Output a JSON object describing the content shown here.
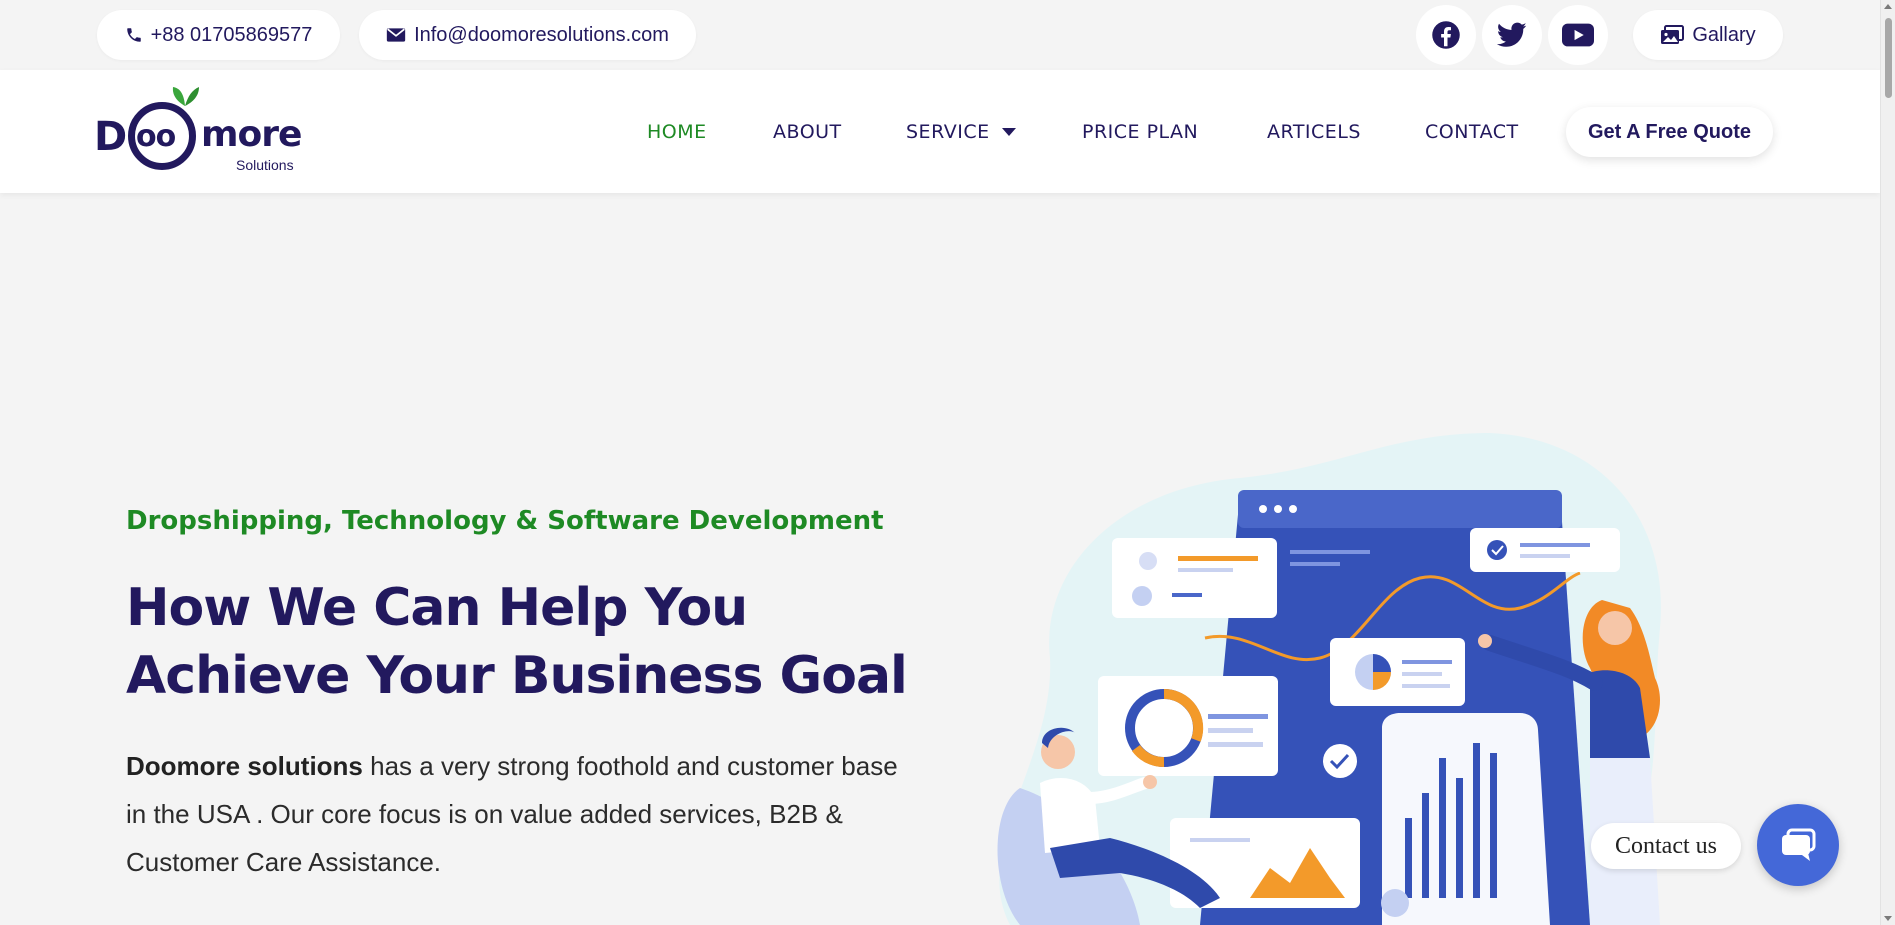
{
  "topbar": {
    "phone": "+88 01705869577",
    "email": "Info@doomoresolutions.com",
    "gallery": "Gallary",
    "icons": {
      "phone": "phone-icon",
      "email": "envelope-icon",
      "facebook": "facebook-icon",
      "twitter": "twitter-icon",
      "youtube": "youtube-icon",
      "gallery": "images-icon"
    }
  },
  "logo": {
    "d": "D",
    "oo": "oo",
    "more": "more",
    "sub": "Solutions"
  },
  "nav": {
    "items": [
      {
        "label": "HOME",
        "active": true
      },
      {
        "label": "ABOUT"
      },
      {
        "label": "SERVICE"
      },
      {
        "label": "PRICE PLAN"
      },
      {
        "label": "ARTICELS"
      },
      {
        "label": "CONTACT"
      }
    ],
    "cta": "Get A Free Quote"
  },
  "hero": {
    "tagline": "Dropshipping, Technology & Software Development",
    "title_line1": "How We Can Help You",
    "title_line2": "Achieve Your Business Goal",
    "desc_bold": "Doomore solutions",
    "desc_rest": " has a very strong foothold and customer base in the USA . Our core focus is on value added services, B2B & Customer Care Assistance."
  },
  "widget": {
    "label": "Contact us",
    "icon": "chat-icon"
  },
  "colors": {
    "navy": "#22195e",
    "green": "#1e8a24",
    "blue": "#4468d8",
    "background": "#f4f4f4"
  }
}
